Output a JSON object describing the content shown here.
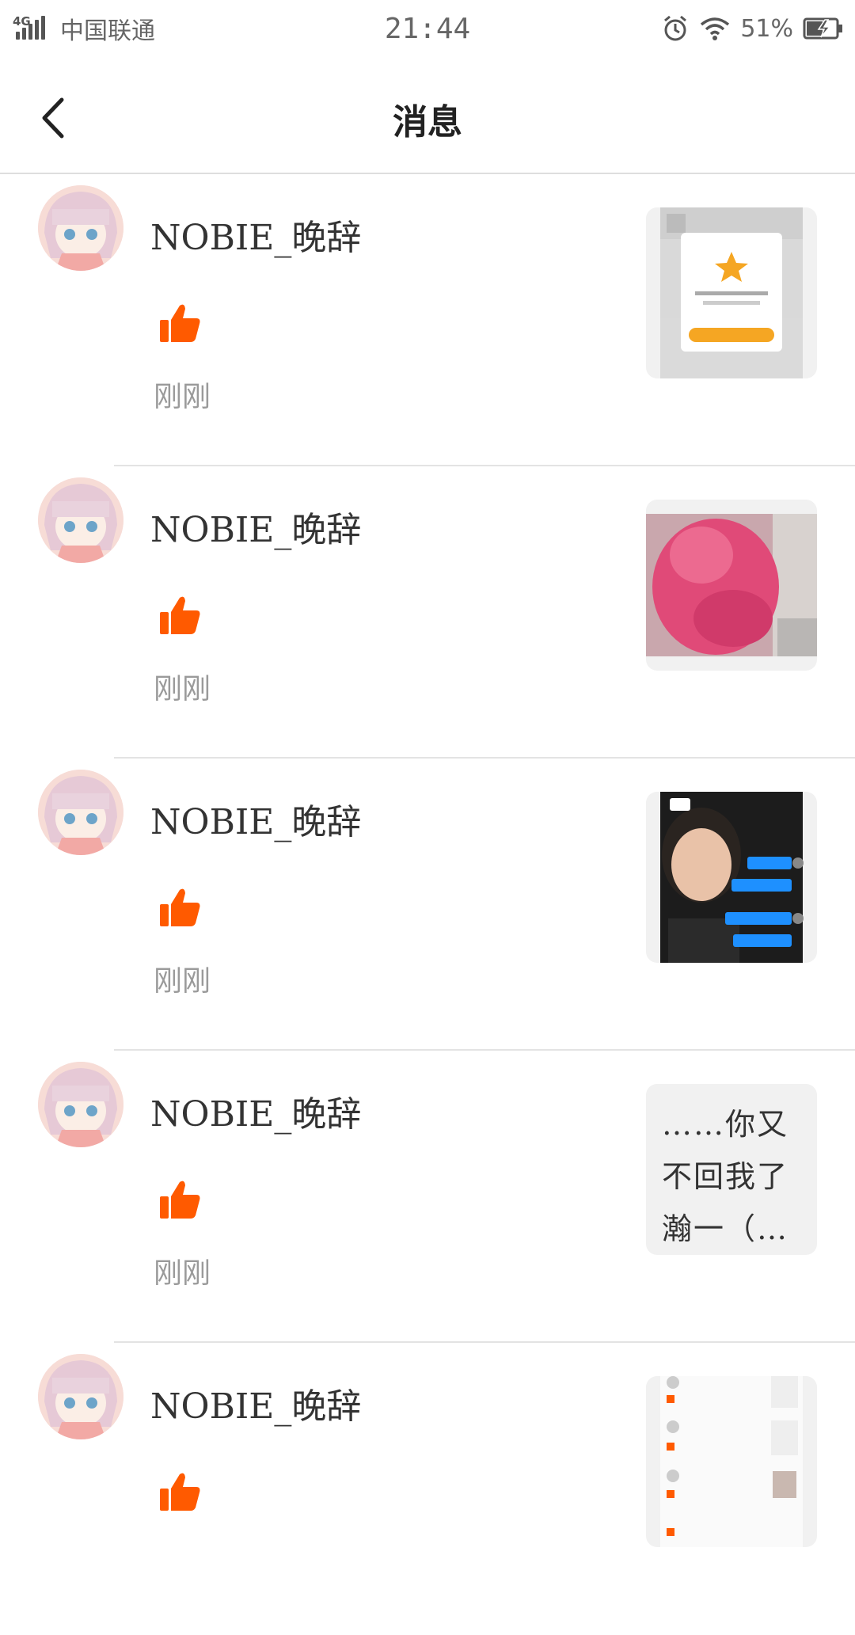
{
  "status_bar": {
    "network": "4G",
    "carrier": "中国联通",
    "time": "21:44",
    "battery": "51%"
  },
  "header": {
    "title": "消息"
  },
  "colors": {
    "accent": "#ff5a00",
    "divider": "#e3e3e3",
    "muted_text": "#9a9a9a"
  },
  "messages": [
    {
      "name": "NOBIE_晚辞",
      "action_icon": "thumbs-up-icon",
      "time": "刚刚",
      "thumb_type": "screenshot-popup"
    },
    {
      "name": "NOBIE_晚辞",
      "action_icon": "thumbs-up-icon",
      "time": "刚刚",
      "thumb_type": "photo-pink"
    },
    {
      "name": "NOBIE_晚辞",
      "action_icon": "thumbs-up-icon",
      "time": "刚刚",
      "thumb_type": "chat-screenshot"
    },
    {
      "name": "NOBIE_晚辞",
      "action_icon": "thumbs-up-icon",
      "time": "刚刚",
      "thumb_type": "text",
      "thumb_text": "……你又不回我了瀚一（…"
    },
    {
      "name": "NOBIE_晚辞",
      "action_icon": "thumbs-up-icon",
      "time": "",
      "thumb_type": "list-screenshot"
    }
  ]
}
